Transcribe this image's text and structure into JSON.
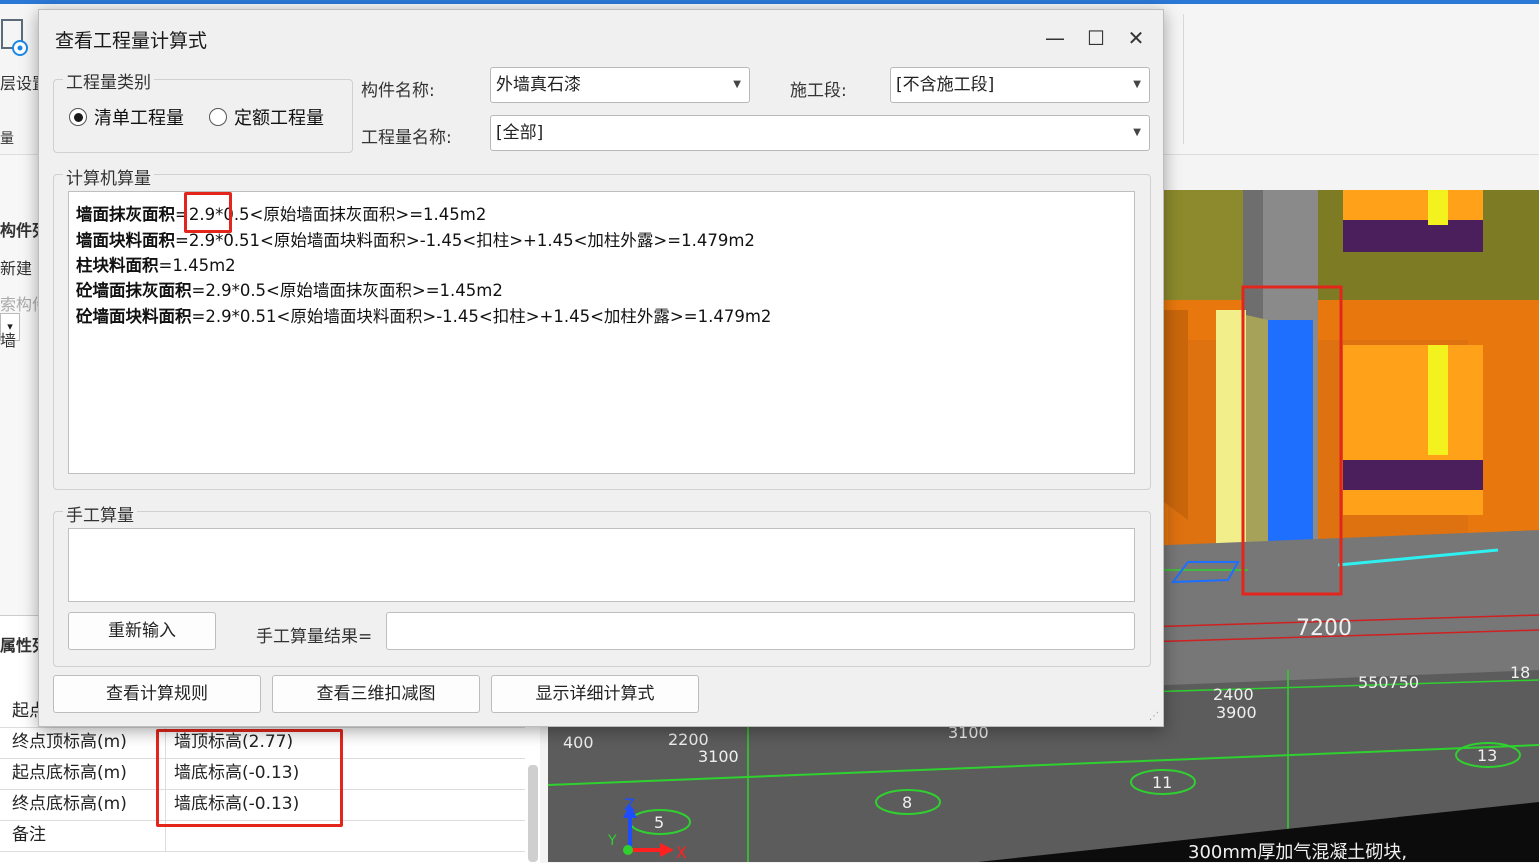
{
  "dialog": {
    "title": "查看工程量计算式",
    "window_buttons": [
      "minimize-icon",
      "maximize-icon",
      "close-icon"
    ],
    "quantity_type": {
      "label": "工程量类别",
      "options": [
        "清单工程量",
        "定额工程量"
      ],
      "selected": "清单工程量"
    },
    "component_name": {
      "label": "构件名称:",
      "value": "外墙真石漆"
    },
    "construction_stage": {
      "label": "施工段:",
      "value": "[不含施工段]"
    },
    "quantity_name": {
      "label": "工程量名称:",
      "value": "[全部]"
    },
    "computer_calc": {
      "label": "计算机算量",
      "lines": [
        {
          "name": "墙面抹灰面积",
          "expr": "=2.9*0.5<原始墙面抹灰面积>=1.45m2"
        },
        {
          "name": "墙面块料面积",
          "expr": "=2.9*0.51<原始墙面块料面积>-1.45<扣柱>+1.45<加柱外露>=1.479m2"
        },
        {
          "name": "柱块料面积",
          "expr": "=1.45m2"
        },
        {
          "name": "砼墙面抹灰面积",
          "expr": "=2.9*0.5<原始墙面抹灰面积>=1.45m2"
        },
        {
          "name": "砼墙面块料面积",
          "expr": "=2.9*0.51<原始墙面块料面积>-1.45<扣柱>+1.45<加柱外露>=1.479m2"
        }
      ]
    },
    "manual_calc": {
      "label": "手工算量",
      "reenter_button": "重新输入",
      "result_label": "手工算量结果=",
      "result_value": ""
    },
    "buttons": {
      "view_rules": "查看计算规则",
      "view_3d": "查看三维扣减图",
      "show_detail": "显示详细计算式"
    }
  },
  "background": {
    "ribbon_label": "层设置",
    "ribbon_small": "量",
    "left_panel": [
      "构件列",
      "新建",
      "索构件",
      "墙"
    ],
    "properties": {
      "title": "属性列",
      "rows": [
        {
          "key": "起点",
          "value": ""
        },
        {
          "key": "终点顶标高(m)",
          "value": "墙顶标高(2.77)"
        },
        {
          "key": "起点底标高(m)",
          "value": "墙底标高(-0.13)"
        },
        {
          "key": "终点底标高(m)",
          "value": "墙底标高(-0.13)"
        },
        {
          "key": "备注",
          "value": ""
        }
      ]
    },
    "viewport": {
      "dimensions": [
        "7200",
        "2400",
        "3900",
        "550750",
        "2200",
        "3100",
        "400",
        "3100",
        "18"
      ],
      "axis_bubbles": [
        "5",
        "8",
        "11",
        "13"
      ],
      "axes": [
        "Z",
        "X",
        "Y"
      ],
      "wall_label": "300mm厚加气混凝土砌块,"
    }
  },
  "colors": {
    "highlight": "#e3261c",
    "selected_column": "#1f6fff",
    "wall_orange": "#e8780e",
    "wall_olive": "#8c8a2c",
    "grid_green": "#2fd12f"
  }
}
